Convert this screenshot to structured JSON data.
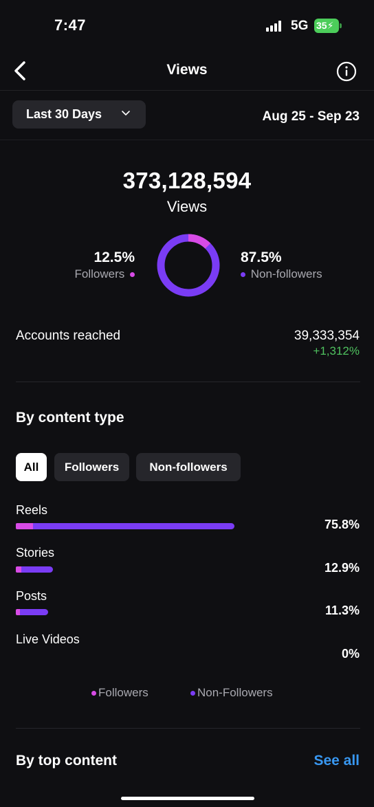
{
  "status_bar": {
    "time": "7:47",
    "network": "5G",
    "battery": "35"
  },
  "nav": {
    "title": "Views"
  },
  "range": {
    "selector_label": "Last 30 Days",
    "dates": "Aug 25 - Sep 23"
  },
  "summary": {
    "total": "373,128,594",
    "total_label": "Views",
    "followers_pct": "12.5%",
    "followers_label": "Followers",
    "non_followers_pct": "87.5%",
    "non_followers_label": "Non-followers",
    "followers_fraction": 0.125
  },
  "reach": {
    "label": "Accounts reached",
    "value": "39,333,354",
    "change": "+1,312%"
  },
  "content_type": {
    "title": "By content type",
    "filters": [
      "All",
      "Followers",
      "Non-followers"
    ],
    "active_filter": "All",
    "rows": [
      {
        "label": "Reels",
        "value": "75.8%",
        "total": 0.758,
        "followers": 0.06
      },
      {
        "label": "Stories",
        "value": "12.9%",
        "total": 0.129,
        "followers": 0.02
      },
      {
        "label": "Posts",
        "value": "11.3%",
        "total": 0.113,
        "followers": 0.015
      },
      {
        "label": "Live Videos",
        "value": "0%",
        "total": 0,
        "followers": 0
      }
    ],
    "legend": {
      "followers": "Followers",
      "non_followers": "Non-Followers"
    }
  },
  "top_content": {
    "title": "By top content",
    "see_all": "See all"
  },
  "colors": {
    "followers": "#d84be6",
    "non_followers": "#7a3cf4",
    "positive": "#4fc25f",
    "link": "#3897f0"
  },
  "icons": {
    "back": "chevron-left-icon",
    "info": "info-circle-icon",
    "dropdown": "chevron-down-icon"
  }
}
